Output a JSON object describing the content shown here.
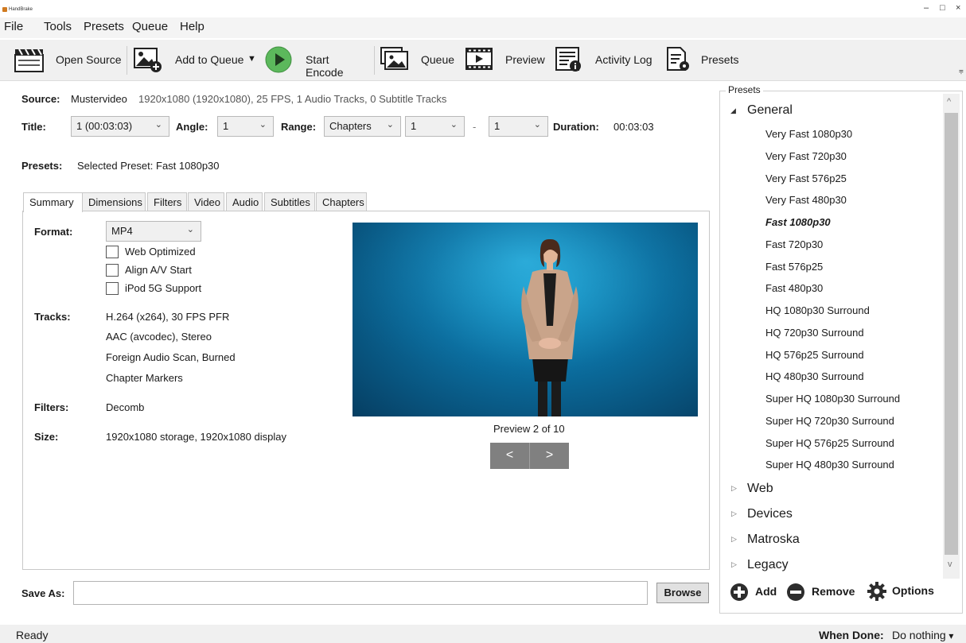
{
  "window": {
    "title": "HandBrake",
    "controls": {
      "minimize": "–",
      "maximize": "□",
      "close": "×"
    }
  },
  "menu": [
    "File",
    "Tools",
    "Presets",
    "Queue",
    "Help"
  ],
  "toolbar": {
    "open_source": "Open Source",
    "add_to_queue": "Add to Queue",
    "start_encode": "Start Encode",
    "queue": "Queue",
    "preview": "Preview",
    "activity_log": "Activity Log",
    "presets": "Presets",
    "dropdown_arrow": "▼",
    "overflow_glyph": "⩦"
  },
  "source": {
    "label": "Source:",
    "name": "Mustervideo",
    "details": "1920x1080 (1920x1080), 25 FPS, 1 Audio Tracks, 0 Subtitle Tracks"
  },
  "title_row": {
    "title_label": "Title:",
    "title_value": "1 (00:03:03)",
    "angle_label": "Angle:",
    "angle_value": "1",
    "range_label": "Range:",
    "range_value": "Chapters",
    "range_start": "1",
    "range_sep": "-",
    "range_end": "1",
    "duration_label": "Duration:",
    "duration_value": "00:03:03"
  },
  "presets_row": {
    "label": "Presets:",
    "value": "Selected Preset: Fast 1080p30"
  },
  "tabs": [
    "Summary",
    "Dimensions",
    "Filters",
    "Video",
    "Audio",
    "Subtitles",
    "Chapters"
  ],
  "summary": {
    "format_label": "Format:",
    "format_value": "MP4",
    "checkboxes": [
      "Web Optimized",
      "Align A/V Start",
      "iPod 5G Support"
    ],
    "tracks_label": "Tracks:",
    "tracks": [
      "H.264 (x264), 30 FPS PFR",
      "AAC (avcodec), Stereo",
      "Foreign Audio Scan, Burned",
      "Chapter Markers"
    ],
    "filters_label": "Filters:",
    "filters_value": "Decomb",
    "size_label": "Size:",
    "size_value": "1920x1080 storage, 1920x1080 display",
    "preview_caption": "Preview 2 of 10",
    "prev_btn": "<",
    "next_btn": ">"
  },
  "save_as": {
    "label": "Save As:",
    "value": "",
    "browse": "Browse"
  },
  "status": {
    "text": "Ready",
    "when_done_label": "When Done:",
    "when_done_value": "Do nothing",
    "when_done_arrow": "▾"
  },
  "preset_panel": {
    "legend": "Presets",
    "general": {
      "label": "General",
      "arrow": "◢",
      "items": [
        "Very Fast 1080p30",
        "Very Fast 720p30",
        "Very Fast 576p25",
        "Very Fast 480p30",
        "Fast 1080p30",
        "Fast 720p30",
        "Fast 576p25",
        "Fast 480p30",
        "HQ 1080p30 Surround",
        "HQ 720p30 Surround",
        "HQ 576p25 Surround",
        "HQ 480p30 Surround",
        "Super HQ 1080p30 Surround",
        "Super HQ 720p30 Surround",
        "Super HQ 576p25 Surround",
        "Super HQ 480p30 Surround"
      ],
      "selected_index": 4
    },
    "collapsed_arrow": "▷",
    "categories": [
      "Web",
      "Devices",
      "Matroska",
      "Legacy"
    ],
    "add": "Add",
    "remove": "Remove",
    "options": "Options",
    "scroll_up": "^",
    "scroll_down": "v"
  },
  "icons": {
    "open_source": "clapperboard-icon",
    "add_to_queue": "add-image-icon",
    "start_encode": "play-icon",
    "queue": "stacked-images-icon",
    "preview": "film-play-icon",
    "activity_log": "log-info-icon",
    "presets": "doc-gear-icon"
  },
  "colors": {
    "toolbar_bg": "#f0f0f0",
    "play_green": "#5cb85c",
    "nav_button": "#808080",
    "video_blue": "#0b6d9e"
  }
}
